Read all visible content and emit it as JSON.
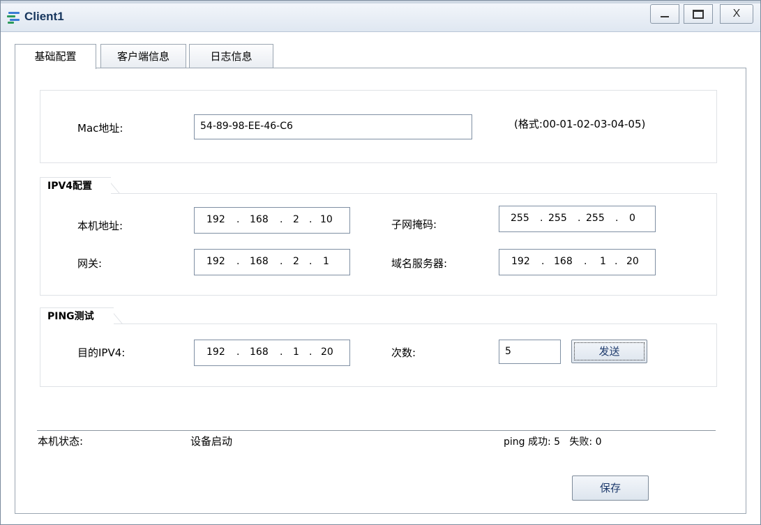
{
  "window": {
    "title": "Client1",
    "buttons": {
      "minimize": "_",
      "maximize": "□",
      "close": "X"
    }
  },
  "tabs": [
    {
      "label": "基础配置",
      "active": true
    },
    {
      "label": "客户端信息",
      "active": false
    },
    {
      "label": "日志信息",
      "active": false
    }
  ],
  "mac": {
    "label": "Mac地址:",
    "value": "54-89-98-EE-46-C6",
    "hint": "(格式:00-01-02-03-04-05)"
  },
  "ipv4": {
    "group_title": "IPV4配置",
    "local_label": "本机地址:",
    "local": [
      "192",
      "168",
      "2",
      "10"
    ],
    "mask_label": "子网掩码:",
    "mask": [
      "255",
      "255",
      "255",
      "0"
    ],
    "gateway_label": "网关:",
    "gateway": [
      "192",
      "168",
      "2",
      "1"
    ],
    "dns_label": "域名服务器:",
    "dns": [
      "192",
      "168",
      "1",
      "20"
    ]
  },
  "ping": {
    "group_title": "PING测试",
    "dest_label": "目的IPV4:",
    "dest": [
      "192",
      "168",
      "1",
      "20"
    ],
    "count_label": "次数:",
    "count": "5",
    "send_label": "发送"
  },
  "status": {
    "label": "本机状态:",
    "value": "设备启动",
    "ping_result": "ping 成功: 5   失败: 0"
  },
  "save_label": "保存",
  "colors": {
    "accent": "#17365d",
    "border": "#7f8fa3"
  }
}
